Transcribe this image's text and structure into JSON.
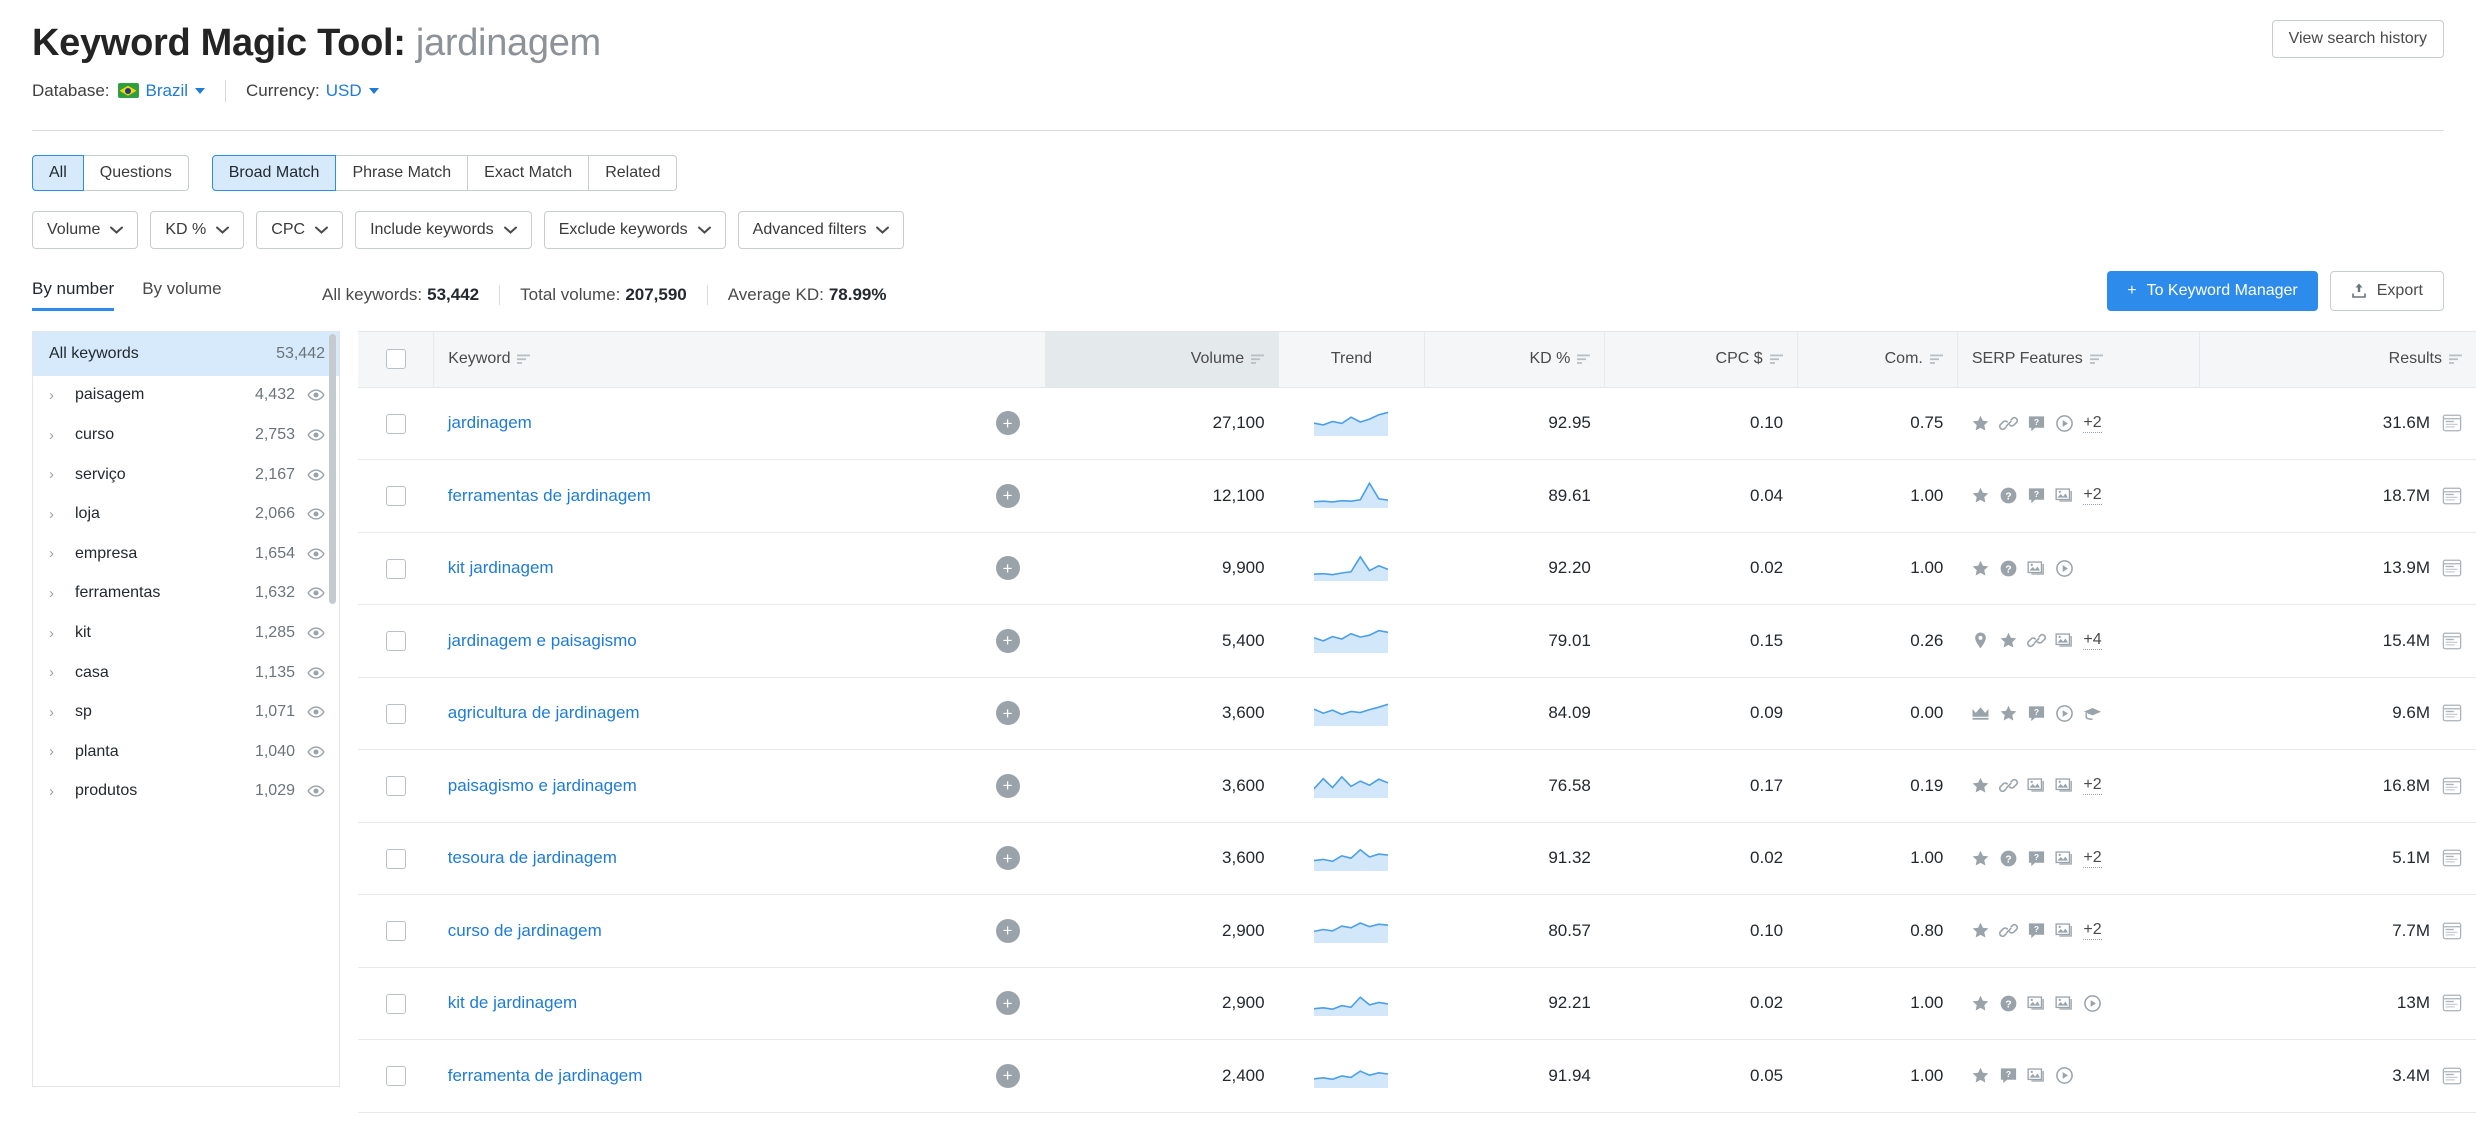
{
  "header": {
    "title_prefix": "Keyword Magic Tool:",
    "keyword": "jardinagem",
    "database_label": "Database:",
    "database_value": "Brazil",
    "currency_label": "Currency:",
    "currency_value": "USD",
    "search_history_button": "View search history"
  },
  "match_tabs": {
    "group1": [
      {
        "label": "All",
        "active": true
      },
      {
        "label": "Questions",
        "active": false
      }
    ],
    "group2": [
      {
        "label": "Broad Match",
        "active": true
      },
      {
        "label": "Phrase Match",
        "active": false
      },
      {
        "label": "Exact Match",
        "active": false
      },
      {
        "label": "Related",
        "active": false
      }
    ]
  },
  "filters": [
    {
      "label": "Volume"
    },
    {
      "label": "KD %"
    },
    {
      "label": "CPC"
    },
    {
      "label": "Include keywords"
    },
    {
      "label": "Exclude keywords"
    },
    {
      "label": "Advanced filters"
    }
  ],
  "subtabs": [
    {
      "label": "By number",
      "active": true
    },
    {
      "label": "By volume",
      "active": false
    }
  ],
  "stats": [
    {
      "label": "All keywords:",
      "value": "53,442"
    },
    {
      "label": "Total volume:",
      "value": "207,590"
    },
    {
      "label": "Average KD:",
      "value": "78.99%"
    }
  ],
  "actions": {
    "keyword_manager": "To Keyword Manager",
    "export": "Export"
  },
  "sidebar": {
    "all": {
      "label": "All keywords",
      "count": "53,442"
    },
    "items": [
      {
        "label": "paisagem",
        "count": "4,432"
      },
      {
        "label": "curso",
        "count": "2,753"
      },
      {
        "label": "serviço",
        "count": "2,167"
      },
      {
        "label": "loja",
        "count": "2,066"
      },
      {
        "label": "empresa",
        "count": "1,654"
      },
      {
        "label": "ferramentas",
        "count": "1,632"
      },
      {
        "label": "kit",
        "count": "1,285"
      },
      {
        "label": "casa",
        "count": "1,135"
      },
      {
        "label": "sp",
        "count": "1,071"
      },
      {
        "label": "planta",
        "count": "1,040"
      },
      {
        "label": "produtos",
        "count": "1,029"
      }
    ]
  },
  "table": {
    "columns": [
      {
        "key": "keyword",
        "label": "Keyword",
        "sortable": true,
        "sorted": false
      },
      {
        "key": "volume",
        "label": "Volume",
        "sortable": true,
        "sorted": true
      },
      {
        "key": "trend",
        "label": "Trend",
        "sortable": false,
        "sorted": false
      },
      {
        "key": "kd",
        "label": "KD %",
        "sortable": true,
        "sorted": false
      },
      {
        "key": "cpc",
        "label": "CPC $",
        "sortable": true,
        "sorted": false
      },
      {
        "key": "com",
        "label": "Com.",
        "sortable": true,
        "sorted": false
      },
      {
        "key": "serp",
        "label": "SERP Features",
        "sortable": true,
        "sorted": false
      },
      {
        "key": "results",
        "label": "Results",
        "sortable": true,
        "sorted": false
      }
    ],
    "rows": [
      {
        "keyword": "jardinagem",
        "volume": "27,100",
        "kd": "92.95",
        "cpc": "0.10",
        "com": "0.75",
        "serp": [
          "star",
          "link",
          "faq",
          "video"
        ],
        "serp_more": "+2",
        "results": "31.6M",
        "trend": [
          0.45,
          0.38,
          0.52,
          0.44,
          0.7,
          0.5,
          0.62,
          0.8,
          0.9
        ]
      },
      {
        "keyword": "ferramentas de jardinagem",
        "volume": "12,100",
        "kd": "89.61",
        "cpc": "0.04",
        "com": "1.00",
        "serp": [
          "star",
          "question",
          "faq",
          "image"
        ],
        "serp_more": "+2",
        "results": "18.7M",
        "trend": [
          0.18,
          0.2,
          0.17,
          0.22,
          0.2,
          0.26,
          0.95,
          0.3,
          0.24
        ]
      },
      {
        "keyword": "kit jardinagem",
        "volume": "9,900",
        "kd": "92.20",
        "cpc": "0.02",
        "com": "1.00",
        "serp": [
          "star",
          "question",
          "image",
          "video"
        ],
        "serp_more": "",
        "results": "13.9M",
        "trend": [
          0.2,
          0.22,
          0.18,
          0.25,
          0.3,
          0.92,
          0.35,
          0.55,
          0.4
        ]
      },
      {
        "keyword": "jardinagem e paisagismo",
        "volume": "5,400",
        "kd": "79.01",
        "cpc": "0.15",
        "com": "0.26",
        "serp": [
          "pin",
          "star",
          "link",
          "image"
        ],
        "serp_more": "+4",
        "results": "15.4M",
        "trend": [
          0.55,
          0.42,
          0.6,
          0.5,
          0.72,
          0.58,
          0.66,
          0.85,
          0.78
        ]
      },
      {
        "keyword": "agricultura de jardinagem",
        "volume": "3,600",
        "kd": "84.09",
        "cpc": "0.09",
        "com": "0.00",
        "serp": [
          "crown",
          "star",
          "faq",
          "video",
          "cap"
        ],
        "serp_more": "",
        "results": "9.6M",
        "trend": [
          0.62,
          0.45,
          0.58,
          0.4,
          0.52,
          0.48,
          0.6,
          0.7,
          0.82
        ]
      },
      {
        "keyword": "paisagismo e jardinagem",
        "volume": "3,600",
        "kd": "76.58",
        "cpc": "0.17",
        "com": "0.19",
        "serp": [
          "star",
          "link",
          "image",
          "image"
        ],
        "serp_more": "+2",
        "results": "16.8M",
        "trend": [
          0.3,
          0.72,
          0.35,
          0.8,
          0.4,
          0.62,
          0.45,
          0.7,
          0.55
        ]
      },
      {
        "keyword": "tesoura de jardinagem",
        "volume": "3,600",
        "kd": "91.32",
        "cpc": "0.02",
        "com": "1.00",
        "serp": [
          "star",
          "question",
          "faq",
          "image"
        ],
        "serp_more": "+2",
        "results": "5.1M",
        "trend": [
          0.35,
          0.4,
          0.32,
          0.55,
          0.45,
          0.8,
          0.5,
          0.62,
          0.58
        ]
      },
      {
        "keyword": "curso de jardinagem",
        "volume": "2,900",
        "kd": "80.57",
        "cpc": "0.10",
        "com": "0.80",
        "serp": [
          "star",
          "link",
          "faq",
          "image"
        ],
        "serp_more": "+2",
        "results": "7.7M",
        "trend": [
          0.4,
          0.48,
          0.42,
          0.62,
          0.55,
          0.75,
          0.6,
          0.7,
          0.66
        ]
      },
      {
        "keyword": "kit de jardinagem",
        "volume": "2,900",
        "kd": "92.21",
        "cpc": "0.02",
        "com": "1.00",
        "serp": [
          "star",
          "question",
          "image",
          "image",
          "video"
        ],
        "serp_more": "",
        "results": "13M",
        "trend": [
          0.22,
          0.26,
          0.2,
          0.35,
          0.28,
          0.7,
          0.38,
          0.48,
          0.42
        ]
      },
      {
        "keyword": "ferramenta de jardinagem",
        "volume": "2,400",
        "kd": "91.94",
        "cpc": "0.05",
        "com": "1.00",
        "serp": [
          "star",
          "faq",
          "image",
          "video"
        ],
        "serp_more": "",
        "results": "3.4M",
        "trend": [
          0.3,
          0.34,
          0.28,
          0.42,
          0.36,
          0.62,
          0.45,
          0.55,
          0.5
        ]
      }
    ]
  },
  "colors": {
    "accent": "#2d8ceb",
    "link": "#1e7bd6",
    "active_tab_bg": "#d6eafc",
    "icon_gray": "#9aa3a9"
  }
}
